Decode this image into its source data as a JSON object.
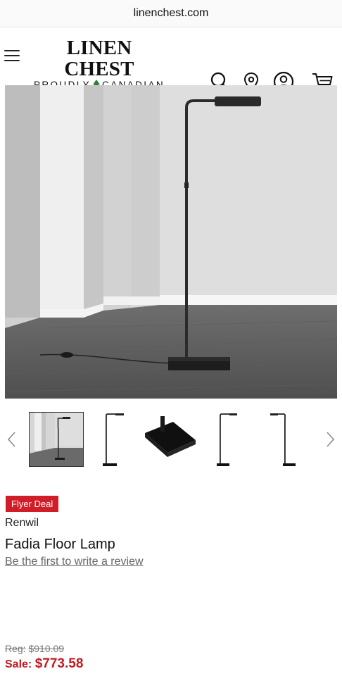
{
  "browser": {
    "url": "linenchest.com"
  },
  "header": {
    "logo_main": "LINEN CHEST",
    "logo_sub_left": "PROUDLY",
    "logo_sub_right": "CANADIAN",
    "icons": [
      "menu-icon",
      "search-icon",
      "location-pin-icon",
      "account-icon",
      "cart-icon"
    ]
  },
  "gallery": {
    "thumbnail_count": 5,
    "selected_index": 0
  },
  "product": {
    "badge": "Flyer Deal",
    "brand": "Renwil",
    "name": "Fadia Floor Lamp",
    "review_link": "Be the first to write a review",
    "reg_label": "Reg:",
    "reg_price": "$910.09",
    "sale_label": "Sale:",
    "sale_price": "$773.58"
  },
  "colors": {
    "sale_red": "#c11b24",
    "badge_red": "#d11d28"
  }
}
